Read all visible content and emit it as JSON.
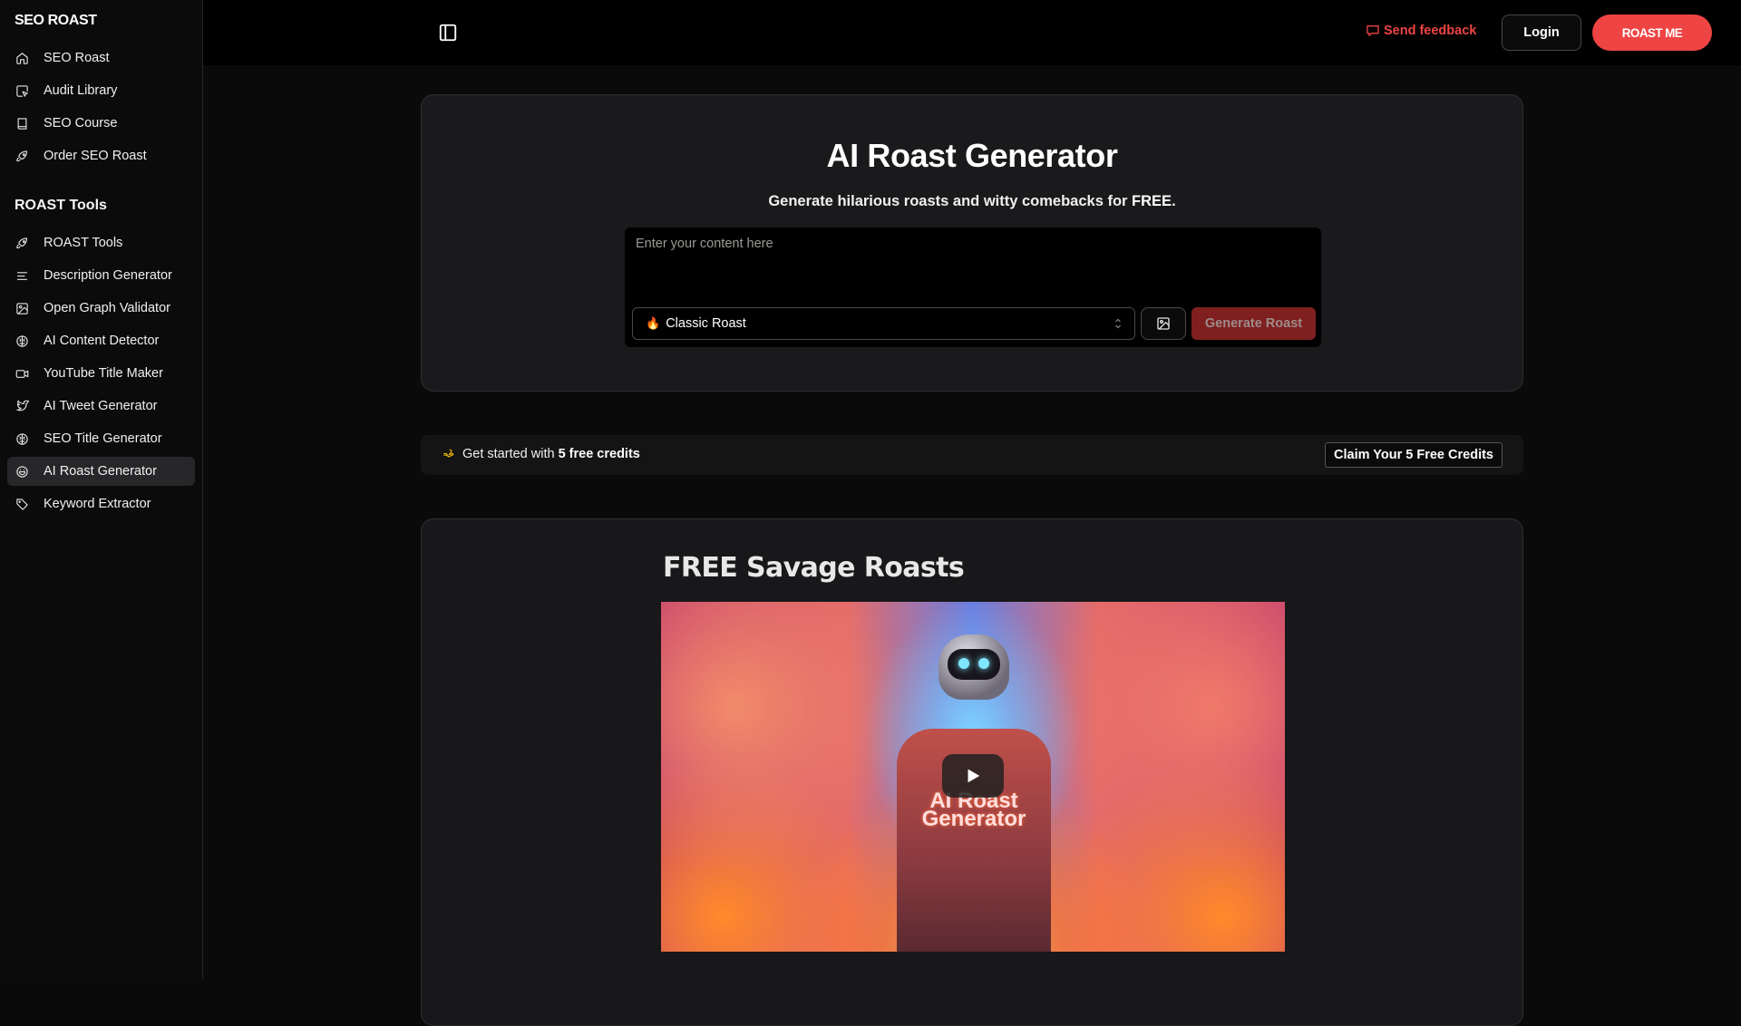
{
  "sidebar": {
    "brand": "SEO ROAST",
    "main_items": [
      {
        "label": "SEO Roast",
        "icon": "home-icon"
      },
      {
        "label": "Audit Library",
        "icon": "cursor-square-icon"
      },
      {
        "label": "SEO Course",
        "icon": "book-icon"
      },
      {
        "label": "Order SEO Roast",
        "icon": "rocket-icon"
      }
    ],
    "section_title": "ROAST Tools",
    "tool_items": [
      {
        "label": "ROAST Tools",
        "icon": "rocket-icon"
      },
      {
        "label": "Description Generator",
        "icon": "text-lines-icon"
      },
      {
        "label": "Open Graph Validator",
        "icon": "image-icon"
      },
      {
        "label": "AI Content Detector",
        "icon": "brain-icon"
      },
      {
        "label": "YouTube Title Maker",
        "icon": "video-icon"
      },
      {
        "label": "AI Tweet Generator",
        "icon": "twitter-icon"
      },
      {
        "label": "SEO Title Generator",
        "icon": "brain-icon"
      },
      {
        "label": "AI Roast Generator",
        "icon": "smile-icon",
        "active": true
      },
      {
        "label": "Keyword Extractor",
        "icon": "tag-icon"
      }
    ]
  },
  "topbar": {
    "feedback_label": "Send feedback",
    "login_label": "Login",
    "cta_label": "ROAST ME"
  },
  "generator": {
    "title": "AI Roast Generator",
    "subtitle_prefix": "Generate hilarious roasts and witty comebacks for ",
    "subtitle_bold": "FREE",
    "subtitle_suffix": ".",
    "input_placeholder": "Enter your content here",
    "input_value": "",
    "style_emoji": "🔥",
    "style_selected": "Classic Roast",
    "generate_label": "Generate Roast"
  },
  "credits": {
    "prefix": "Get started with ",
    "bold": "5 free credits",
    "claim_label": "Claim Your 5 Free Credits"
  },
  "showcase": {
    "title": "FREE Savage Roasts",
    "video_overlay_text": "AI Roast Generator"
  },
  "colors": {
    "accent": "#ef4444",
    "generate_disabled": "#7f1f1f",
    "active_nav": "#27272a"
  }
}
